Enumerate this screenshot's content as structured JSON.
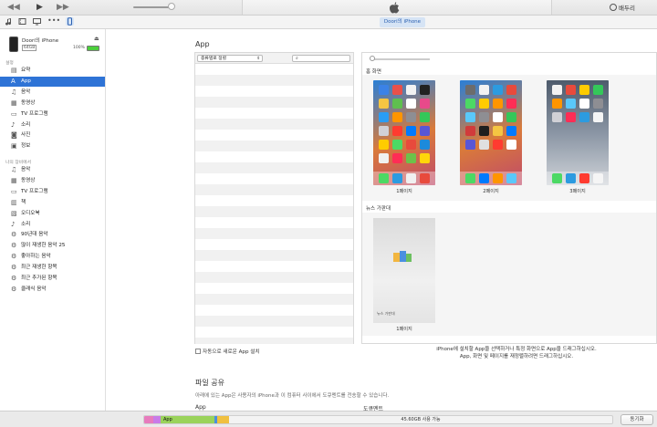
{
  "toolbar": {
    "account": "배두리",
    "buttons": [
      "prev",
      "play",
      "next"
    ]
  },
  "navbar": {
    "device_tab": "Doori의 iPhone",
    "icons": [
      "music-note-icon",
      "tv-icon",
      "more-icon",
      "iphone-icon"
    ]
  },
  "device": {
    "name": "Doori의 iPhone",
    "capacity": "64GB",
    "battery": "100%"
  },
  "sidebar": {
    "settings_title": "설정",
    "settings_items": [
      {
        "label": "요약",
        "icon": "summary-icon"
      },
      {
        "label": "App",
        "icon": "app-store-icon",
        "active": true
      },
      {
        "label": "음악",
        "icon": "music-icon"
      },
      {
        "label": "동영상",
        "icon": "movie-icon"
      },
      {
        "label": "TV 프로그램",
        "icon": "tv-icon"
      },
      {
        "label": "소리",
        "icon": "bell-icon"
      },
      {
        "label": "사진",
        "icon": "camera-icon"
      },
      {
        "label": "정보",
        "icon": "info-icon"
      }
    ],
    "library_title": "나의 장비에서",
    "library_items": [
      {
        "label": "음악",
        "icon": "music-icon"
      },
      {
        "label": "동영상",
        "icon": "movie-icon"
      },
      {
        "label": "TV 프로그램",
        "icon": "tv-icon"
      },
      {
        "label": "책",
        "icon": "book-icon"
      },
      {
        "label": "오디오북",
        "icon": "audiobook-icon"
      },
      {
        "label": "소리",
        "icon": "bell-icon"
      },
      {
        "label": "90년대 음악",
        "icon": "gear-icon"
      },
      {
        "label": "많이 재생한 음악 25",
        "icon": "gear-icon"
      },
      {
        "label": "좋아하는 음악",
        "icon": "gear-icon"
      },
      {
        "label": "최근 재생한 항목",
        "icon": "gear-icon"
      },
      {
        "label": "최근 추가된 항목",
        "icon": "gear-icon"
      },
      {
        "label": "클래식 음악",
        "icon": "gear-icon"
      }
    ]
  },
  "main": {
    "title": "App",
    "sort_label": "종류별로 정렬",
    "home_screen_title": "홈 화면",
    "pages": [
      "1페이지",
      "2페이지",
      "3페이지"
    ],
    "news_title": "뉴스 가판대",
    "news_page": "1페이지",
    "news_inner_label": "뉴스 가판대",
    "auto_install": "자동으로 새로운 App 설치",
    "hint_line1": "iPhone에 설치할 App을 선택하거나 특정 화면으로 App을 드래그하십시오.",
    "hint_line2": "App, 화면 및 페이지를 재정렬하려면 드래그하십시오.",
    "file_sharing_title": "파일 공유",
    "file_sharing_desc": "아래에 있는 App은 사용자의 iPhone과 이 컴퓨터 사이에서 도큐멘트를 전송할 수 있습니다.",
    "fs_app_col": "App",
    "fs_docs_col": "도큐멘트"
  },
  "capacity_bar": {
    "app_label": "App",
    "free_label": "45.60GB 사용 가능",
    "colors": {
      "audio": "#e77bbd",
      "photo": "#f2d25a",
      "app": "#9ad35b",
      "other": "#f0c040"
    }
  },
  "sync_button": "동기화"
}
